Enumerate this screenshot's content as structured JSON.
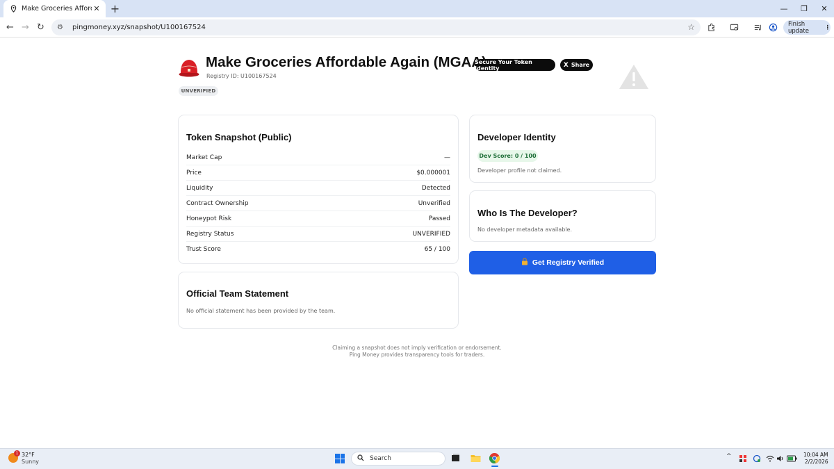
{
  "browser": {
    "tab_title": "Make Groceries Affordable Again (MGAA)",
    "url": "pingmoney.xyz/snapshot/U100167524",
    "finish_update_label": "Finish update"
  },
  "header": {
    "title": "Make Groceries Affordable Again (MGAA)",
    "secure_button": "Secure Your Token Identity",
    "share_button": "Share",
    "share_icon_glyph": "X",
    "registry_id": "Registry ID: U100167524",
    "status_badge": "UNVERIFIED"
  },
  "snapshot": {
    "title": "Token Snapshot (Public)",
    "rows": [
      {
        "label": "Market Cap",
        "value": "—"
      },
      {
        "label": "Price",
        "value": "$0.000001"
      },
      {
        "label": "Liquidity",
        "value": "Detected"
      },
      {
        "label": "Contract Ownership",
        "value": "Unverified"
      },
      {
        "label": "Honeypot Risk",
        "value": "Passed"
      },
      {
        "label": "Registry Status",
        "value": "UNVERIFIED"
      },
      {
        "label": "Trust Score",
        "value": "65 / 100"
      }
    ]
  },
  "statement": {
    "title": "Official Team Statement",
    "text": "No official statement has been provided by the team."
  },
  "developer": {
    "title": "Developer Identity",
    "score_badge": "Dev Score: 0 / 100",
    "profile_text": "Developer profile not claimed."
  },
  "who": {
    "title": "Who Is The Developer?",
    "text": "No developer metadata available."
  },
  "cta": {
    "label": "Get Registry Verified",
    "icon": "lock-icon"
  },
  "disclaimer": {
    "line1": "Claiming a snapshot does not imply verification or endorsement.",
    "line2": "Ping Money provides transparency tools for traders."
  },
  "taskbar": {
    "weather_badge": "1",
    "temperature": "32°F",
    "condition": "Sunny",
    "search_placeholder": "Search",
    "time": "10:04 AM",
    "date": "2/2/2026"
  },
  "colors": {
    "cta_blue": "#1f5fe6",
    "dark_pill": "#0c0c0c",
    "dev_score_bg": "#e7f7ea",
    "dev_score_text": "#1e6e38",
    "chrome_tabstrip": "#d8e3f5"
  }
}
